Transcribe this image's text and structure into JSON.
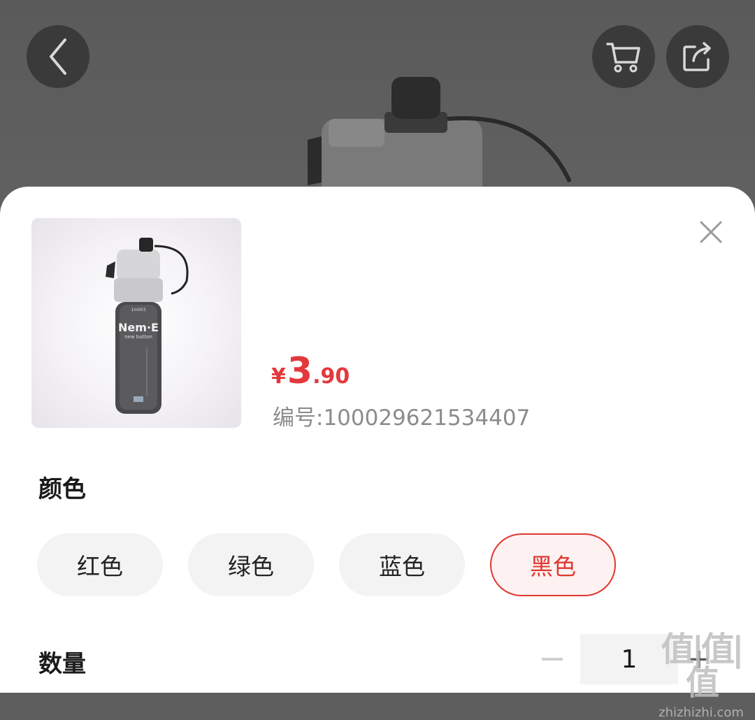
{
  "header": {
    "back_icon": "chevron-left-icon",
    "cart_icon": "cart-icon",
    "share_icon": "share-icon"
  },
  "product": {
    "price_symbol": "¥",
    "price_integer": "3",
    "price_decimal": ".90",
    "sku_text": "编号:100029621534407",
    "thumb_brand": "Nem·E",
    "thumb_sub": "new button",
    "thumb_tag": "1m003"
  },
  "color_section": {
    "title": "颜色",
    "options": [
      {
        "label": "红色",
        "selected": false
      },
      {
        "label": "绿色",
        "selected": false
      },
      {
        "label": "蓝色",
        "selected": false
      },
      {
        "label": "黑色",
        "selected": true
      }
    ]
  },
  "quantity_section": {
    "title": "数量",
    "value": "1",
    "plus_label": "+"
  },
  "watermark": {
    "logo": "值|值|值",
    "text": "zhizhizhi.com"
  },
  "colors": {
    "accent": "#e4393c",
    "chip_bg": "#f3f3f3"
  }
}
